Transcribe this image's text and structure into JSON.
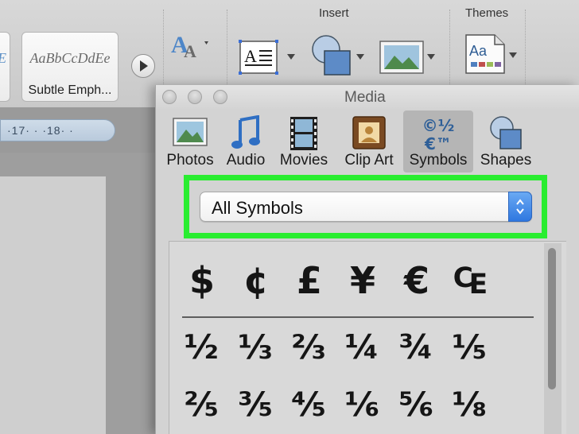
{
  "ribbon": {
    "groups": {
      "insert_label": "Insert",
      "themes_label": "Themes"
    },
    "styles": [
      {
        "sample": "E",
        "name": ""
      },
      {
        "sample": "AaBbCcDdEe",
        "name": "Subtle Emph..."
      }
    ],
    "ruler_text": "·17· · ·18· ·"
  },
  "media": {
    "title": "Media",
    "tabs": [
      {
        "label": "Photos",
        "icon": "photo-icon"
      },
      {
        "label": "Audio",
        "icon": "music-note-icon"
      },
      {
        "label": "Movies",
        "icon": "film-strip-icon"
      },
      {
        "label": "Clip Art",
        "icon": "clip-art-icon"
      },
      {
        "label": "Symbols",
        "icon": "symbols-icon",
        "glyph_top": "©½",
        "glyph_bottom": "€™"
      },
      {
        "label": "Shapes",
        "icon": "shapes-icon"
      }
    ],
    "selected_tab": "Symbols",
    "category_select": {
      "value": "All Symbols"
    },
    "symbols": {
      "currency": [
        "$",
        "¢",
        "£",
        "¥",
        "€",
        "₠"
      ],
      "fractions_row1": [
        "½",
        "⅓",
        "⅔",
        "¼",
        "¾",
        "⅕"
      ],
      "fractions_row2": [
        "⅖",
        "⅗",
        "⅘",
        "⅙",
        "⅚",
        "⅛"
      ]
    }
  },
  "colors": {
    "highlight": "#29ed30",
    "select_accent": "#2f78e0"
  }
}
